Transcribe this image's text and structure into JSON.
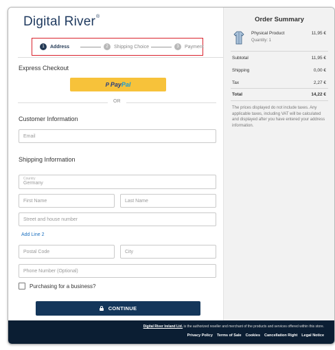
{
  "brand": {
    "name": "Digital River",
    "tm": "®"
  },
  "stepper": [
    {
      "num": "1",
      "label": "Address"
    },
    {
      "num": "2",
      "label": "Shipping Choice"
    },
    {
      "num": "3",
      "label": "Payment"
    }
  ],
  "express": {
    "title": "Express Checkout",
    "paypal_pay": "Pay",
    "paypal_pal": "Pal",
    "paypal_mark": "P",
    "or": "OR"
  },
  "customer": {
    "title": "Customer Information",
    "email_placeholder": "Email"
  },
  "shipping": {
    "title": "Shipping Information",
    "country_caption": "Country",
    "country_value": "Germany",
    "first_name": "First Name",
    "last_name": "Last Name",
    "street": "Street and house number",
    "add_line2": "Add Line 2",
    "postal_code": "Postal Code",
    "city": "City",
    "phone": "Phone Number (Optional)",
    "business_checkbox": "Purchasing for a business?"
  },
  "continue_label": "CONTINUE",
  "footer": {
    "company": "Digital River Ireland Ltd.",
    "reseller_text": " is the authorized reseller and merchant of the products and services offered within this store.",
    "links": [
      "Privacy Policy",
      "Terms of Sale",
      "Cookies",
      "Cancellation Right",
      "Legal Notice"
    ]
  },
  "order_summary": {
    "title": "Order Summary",
    "product": {
      "name": "Physical Product",
      "quantity": "Quantity: 1",
      "price": "11,95 €",
      "icon": "shirt-icon"
    },
    "subtotal_label": "Subtotal",
    "subtotal": "11,95 €",
    "shipping_label": "Shipping",
    "shipping": "0,00 €",
    "tax_label": "Tax",
    "tax": "2,27 €",
    "total_label": "Total",
    "total": "14,22 €",
    "note": "The prices displayed do not include taxes. Any applicable taxes, including VAT will be calculated and displayed after you have entered your address information."
  },
  "colors": {
    "brand": "#1f3a5f",
    "continue": "#14365a",
    "paypal": "#f7c23a",
    "highlight": "#d9202a",
    "footer": "#0b1e33"
  }
}
